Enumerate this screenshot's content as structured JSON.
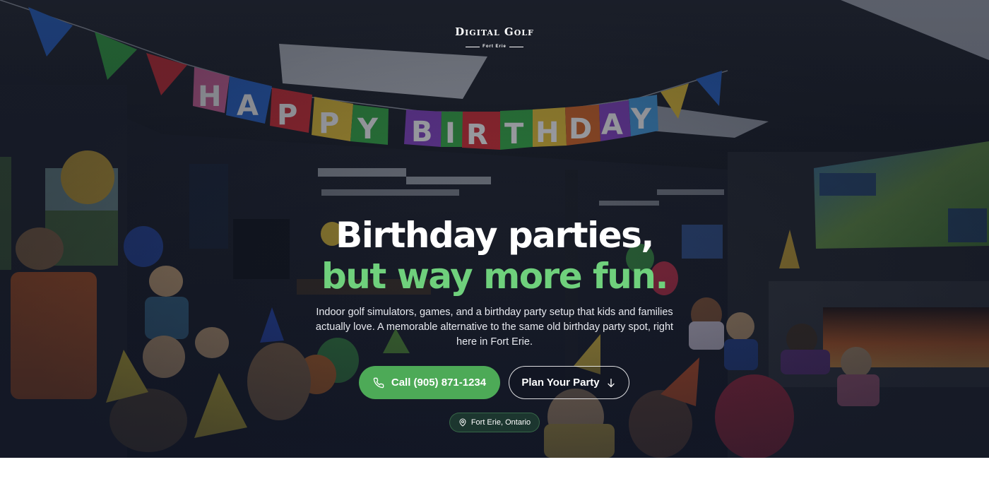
{
  "logo": {
    "name": "Digital Golf",
    "location": "Fort Erie"
  },
  "hero": {
    "banner_text": "HAPPY BIRTHDAY",
    "headline_line1": "Birthday parties,",
    "headline_line2": "but way more fun.",
    "subtext": "Indoor golf simulators, games, and a birthday party setup that kids and families actually love. A memorable alternative to the same old birthday party spot, right here in Fort Erie.",
    "accent_color": "#6fd07c",
    "primary_button_color": "#4daa57"
  },
  "buttons": {
    "call_label": "Call (905) 871-1234",
    "call_icon": "phone-icon",
    "plan_label": "Plan Your Party",
    "plan_icon": "arrow-down-icon"
  },
  "location_badge": {
    "label": "Fort Erie, Ontario",
    "icon": "map-pin-icon"
  }
}
